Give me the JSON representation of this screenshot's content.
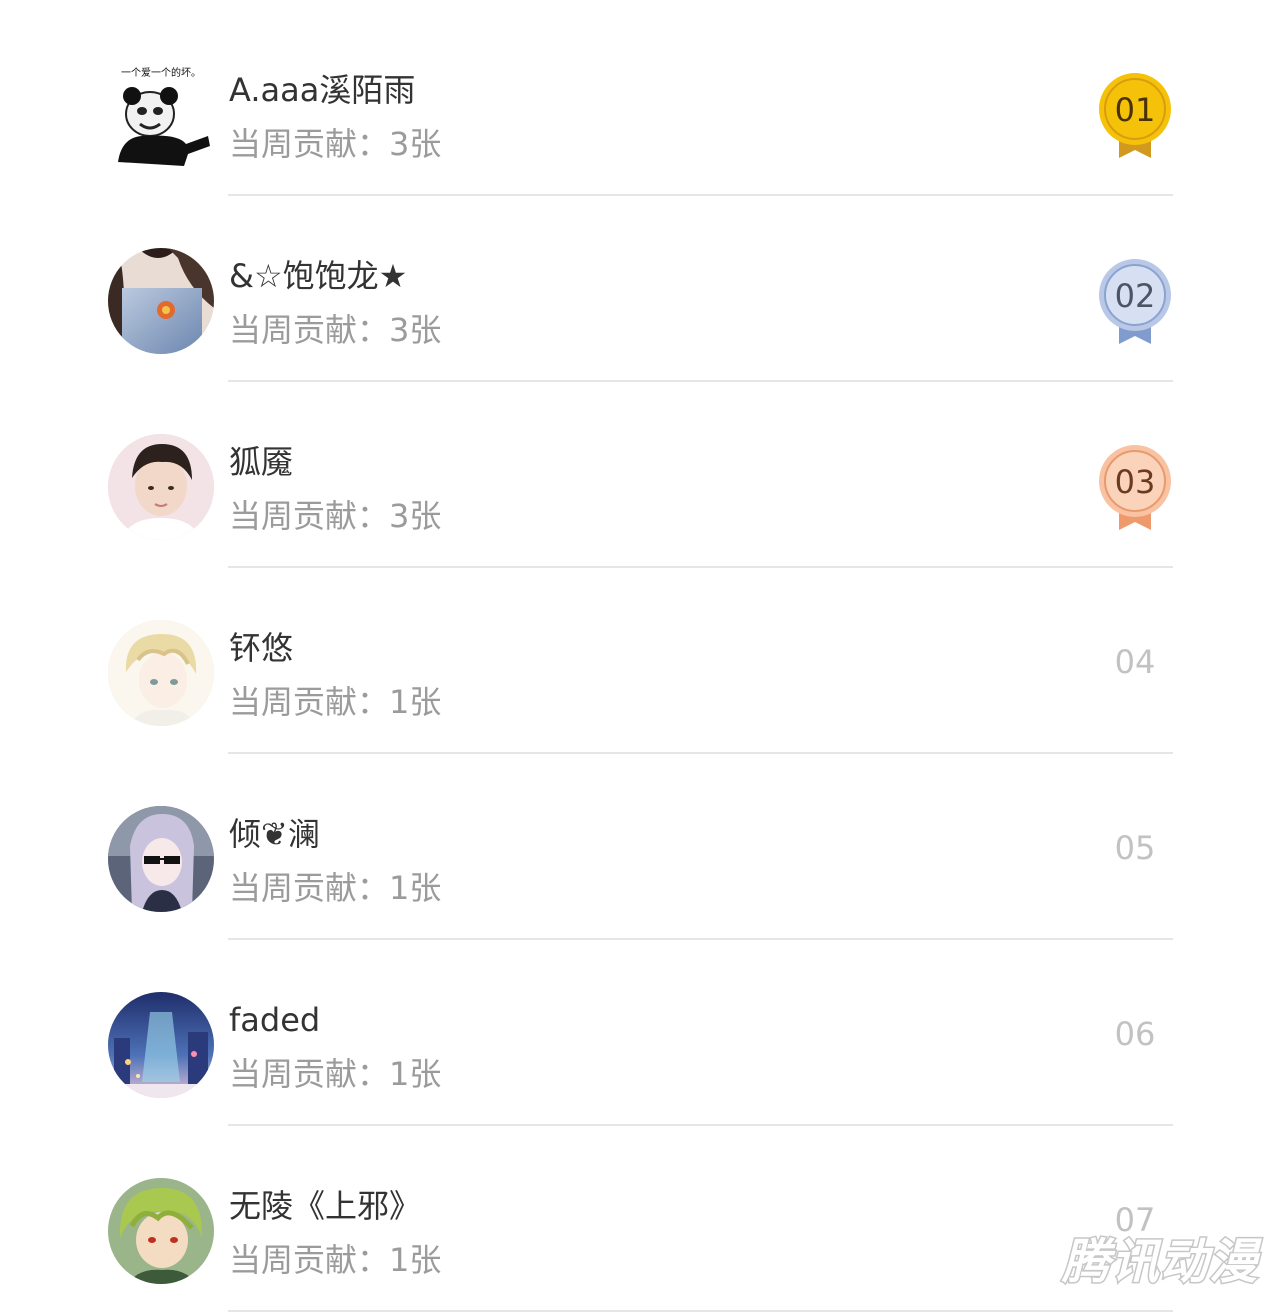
{
  "ranking": [
    {
      "rank": "01",
      "name": "A.aaa溪陌雨",
      "contribution": "当周贡献：3张",
      "medal": "gold",
      "avatar": "panda-meme-avatar",
      "avatar_caption": "一个爱一个的坏。"
    },
    {
      "rank": "02",
      "name": "&☆饱饱龙★",
      "contribution": "当周贡献：3张",
      "medal": "silver",
      "avatar": "girl-photo-avatar"
    },
    {
      "rank": "03",
      "name": "狐魇",
      "contribution": "当周贡献：3张",
      "medal": "bronze",
      "avatar": "boy-photo-avatar"
    },
    {
      "rank": "04",
      "name": "钚悠",
      "contribution": "当周贡献：1张",
      "avatar": "anime-blond-boy-avatar"
    },
    {
      "rank": "05",
      "name": "倾❦澜",
      "contribution": "当周贡献：1张",
      "avatar": "anime-sunglasses-girl-avatar"
    },
    {
      "rank": "06",
      "name": "faded",
      "contribution": "当周贡献：1张",
      "avatar": "city-night-avatar"
    },
    {
      "rank": "07",
      "name": "无陵《上邪》",
      "contribution": "当周贡献：1张",
      "avatar": "anime-green-hair-avatar"
    }
  ],
  "colors": {
    "gold": "#f5c20a",
    "gold_ribbon": "#d19a1e",
    "silver": "#b8c8e6",
    "silver_ribbon": "#7f9ccc",
    "bronze": "#f9c2a2",
    "bronze_ribbon": "#ee9a6c",
    "name_text": "#333333",
    "secondary_text": "#9b9b9b",
    "rank_text": "#c2c2c2",
    "divider": "#e6e6e6"
  },
  "watermark": "腾讯动漫"
}
